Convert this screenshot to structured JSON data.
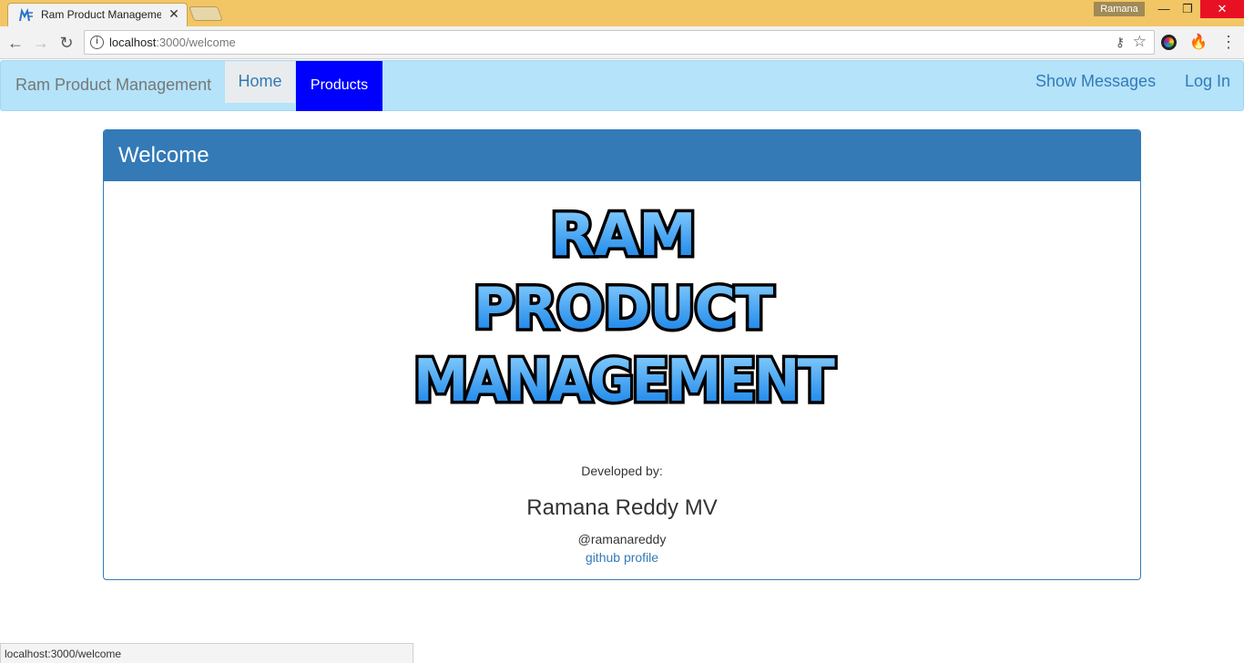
{
  "browser": {
    "tab_title": "Ram Product Management",
    "profile_name": "Ramana",
    "url_host": "localhost",
    "url_path": ":3000/welcome",
    "status_url": "localhost:3000/welcome"
  },
  "navbar": {
    "brand": "Ram Product Management",
    "home_label": "Home",
    "products_label": "Products",
    "messages_label": "Show Messages",
    "login_label": "Log In"
  },
  "panel": {
    "title": "Welcome",
    "logo_lines": [
      "RAM",
      "PRODUCT",
      "MANAGEMENT"
    ],
    "developed_by": "Developed by:",
    "developer_name": "Ramana Reddy MV",
    "handle": "@ramanareddy",
    "github_link": "github profile"
  },
  "colors": {
    "navbar_bg": "#b4e3fa",
    "products_active": "#0000ff",
    "panel_primary": "#337ab7",
    "titlebar": "#f2c665"
  }
}
